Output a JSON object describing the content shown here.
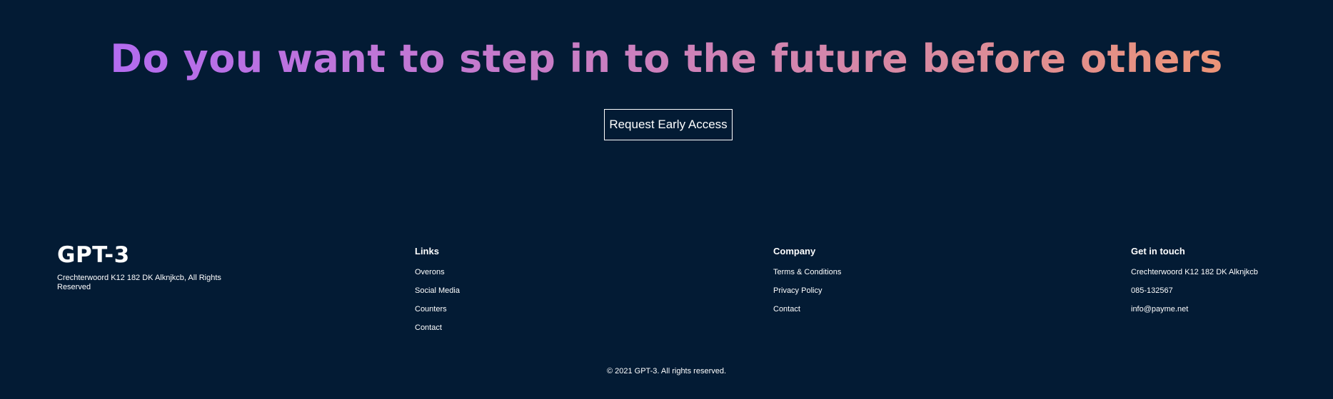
{
  "cta": {
    "heading": "Do you want to step in to the future before others",
    "button_label": "Request Early Access"
  },
  "footer": {
    "logo": "GPT-3",
    "address": "Crechterwoord K12 182 DK Alknjkcb, All Rights Reserved",
    "links": {
      "title": "Links",
      "items": [
        "Overons",
        "Social Media",
        "Counters",
        "Contact"
      ]
    },
    "company": {
      "title": "Company",
      "items": [
        "Terms & Conditions",
        "Privacy Policy",
        "Contact"
      ]
    },
    "contact": {
      "title": "Get in touch",
      "items": [
        "Crechterwoord K12 182 DK Alknjkcb",
        "085-132567",
        "info@payme.net"
      ]
    },
    "copyright": "© 2021 GPT-3. All rights reserved."
  },
  "colors": {
    "background": "#031b34",
    "gradient_start": "#ae67fa",
    "gradient_end": "#f49867",
    "text": "#ffffff"
  }
}
